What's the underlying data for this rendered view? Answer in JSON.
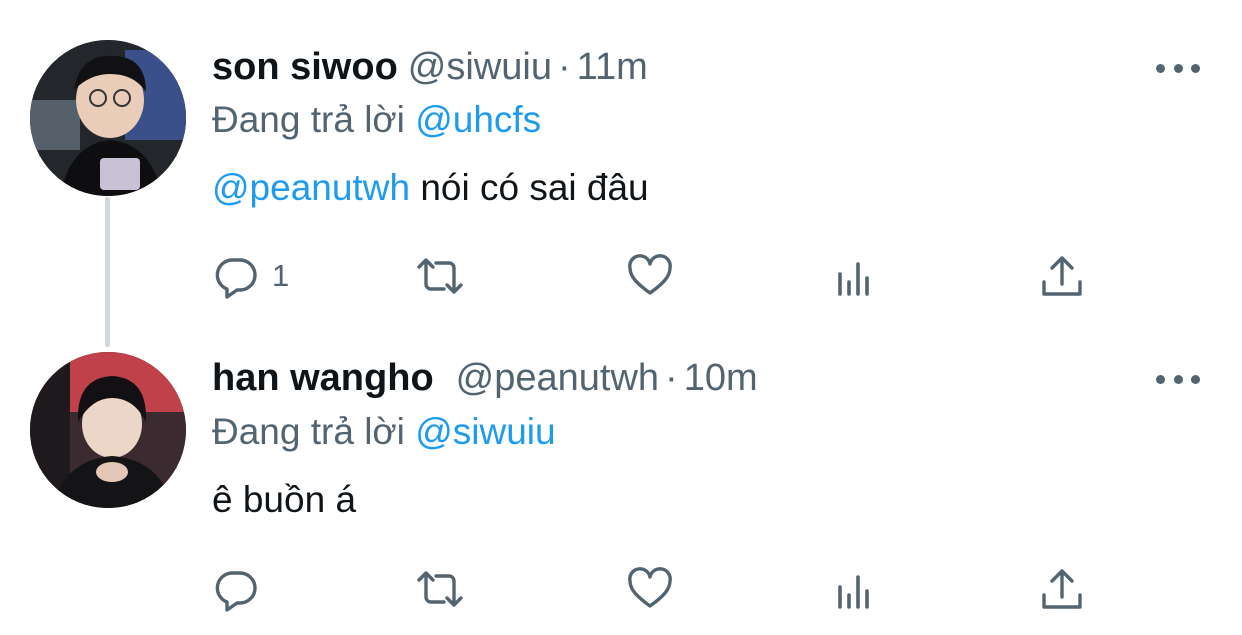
{
  "colors": {
    "text_primary": "#0f1419",
    "text_secondary": "#536471",
    "accent": "#1d9bf0",
    "thread_line": "#cfd9de"
  },
  "tweets": [
    {
      "display_name": "son siwoo",
      "handle": "@siwuiu",
      "separator": "·",
      "time": "11m",
      "reply_prefix": "Đang trả lời",
      "reply_to": "@uhcfs",
      "mention": "@peanutwh",
      "text": "nói có sai đâu",
      "reply_count": "1",
      "icons": [
        "reply-icon",
        "retweet-icon",
        "like-icon",
        "views-icon",
        "share-icon",
        "more-icon"
      ]
    },
    {
      "display_name": "han wangho",
      "handle": "@peanutwh",
      "separator": "·",
      "time": "10m",
      "reply_prefix": "Đang trả lời",
      "reply_to": "@siwuiu",
      "mention": "",
      "text": "ê buồn á",
      "reply_count": "",
      "icons": [
        "reply-icon",
        "retweet-icon",
        "like-icon",
        "views-icon",
        "share-icon",
        "more-icon"
      ]
    }
  ]
}
